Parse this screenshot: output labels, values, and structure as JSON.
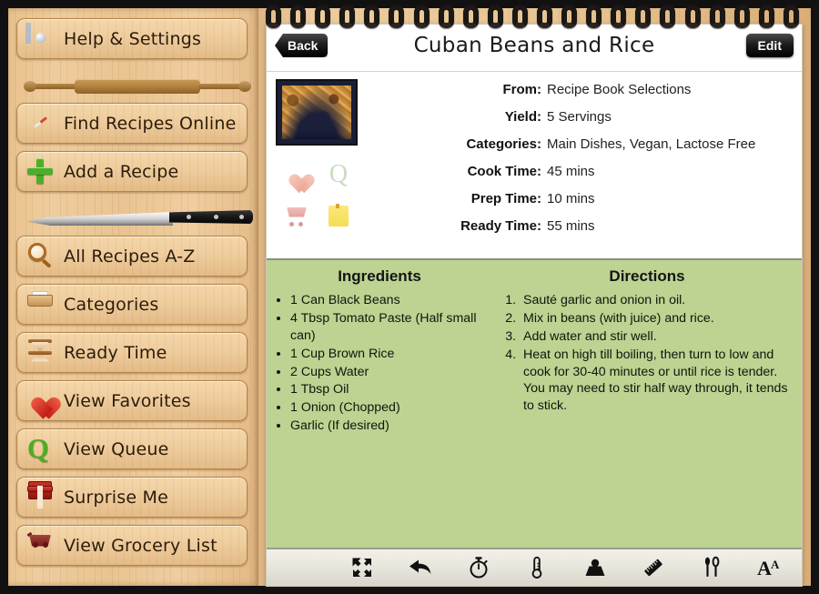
{
  "sidebar": {
    "items": [
      {
        "label": "Help & Settings",
        "icon": "gear-icon"
      },
      {
        "label": "Find Recipes Online",
        "icon": "compass-icon"
      },
      {
        "label": "Add a Recipe",
        "icon": "plus-icon"
      },
      {
        "label": "All Recipes A-Z",
        "icon": "magnifier-icon"
      },
      {
        "label": "Categories",
        "icon": "tray-icon"
      },
      {
        "label": "Ready Time",
        "icon": "hourglass-icon"
      },
      {
        "label": "View Favorites",
        "icon": "heart-icon"
      },
      {
        "label": "View Queue",
        "icon": "queue-q-icon"
      },
      {
        "label": "Surprise Me",
        "icon": "gift-icon"
      },
      {
        "label": "View Grocery List",
        "icon": "shopping-cart-icon"
      }
    ],
    "dividers": [
      "rolling-pin-icon",
      "chef-knife-icon"
    ]
  },
  "header": {
    "back_label": "Back",
    "edit_label": "Edit",
    "title": "Cuban Beans and Rice"
  },
  "recipe": {
    "thumbnail_alt": "recipe-photo",
    "status_icons": [
      "favorite-heart-icon",
      "queue-q-icon",
      "grocery-cart-icon",
      "note-icon"
    ],
    "meta": [
      {
        "label": "From:",
        "value": "Recipe Book Selections"
      },
      {
        "label": "Yield:",
        "value": "5 Servings"
      },
      {
        "label": "Categories:",
        "value": "Main Dishes, Vegan, Lactose Free"
      },
      {
        "label": "Cook Time:",
        "value": "45 mins"
      },
      {
        "label": "Prep Time:",
        "value": "10 mins"
      },
      {
        "label": "Ready Time:",
        "value": "55 mins"
      }
    ],
    "ingredients_title": "Ingredients",
    "ingredients": [
      "1 Can Black Beans",
      "4 Tbsp Tomato Paste (Half small can)",
      "1 Cup Brown Rice",
      "2 Cups Water",
      "1 Tbsp Oil",
      "1 Onion (Chopped)",
      "Garlic (If desired)"
    ],
    "directions_title": "Directions",
    "directions": [
      "Sauté garlic and onion in oil.",
      "Mix in beans (with juice) and rice.",
      "Add water and stir well.",
      "Heat on high till boiling, then turn to low and cook for 30-40 minutes or until rice is tender. You may need to stir half way through, it tends to stick."
    ]
  },
  "toolbar": {
    "buttons": [
      "fullscreen-icon",
      "back-arrow-icon",
      "stopwatch-icon",
      "thermometer-icon",
      "weight-icon",
      "ruler-icon",
      "utensils-icon",
      "font-size-icon"
    ]
  },
  "colors": {
    "wood": "#e9c492",
    "green_panel": "#bcd392",
    "frame": "#111111",
    "accent_green": "#4cae23",
    "accent_red": "#c01b14"
  },
  "spiral": {
    "ring_count": 22
  }
}
